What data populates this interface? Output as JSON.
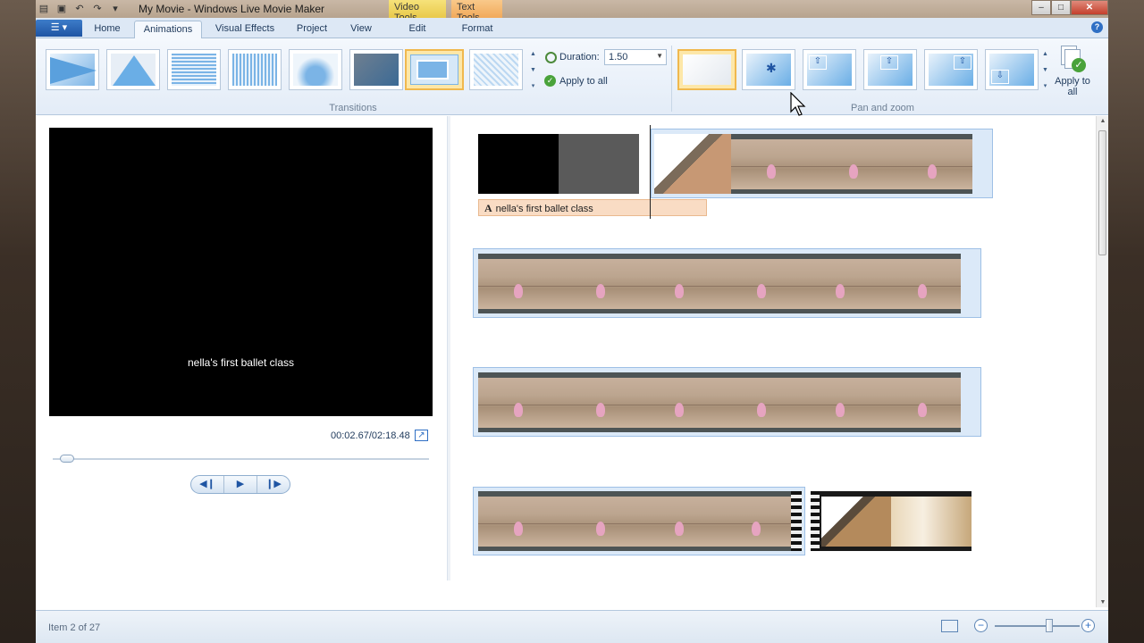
{
  "window": {
    "title": "My Movie - Windows Live Movie Maker",
    "quick_access_icons": [
      "menu-icon",
      "save-icon",
      "undo-icon",
      "redo-icon",
      "customize-icon"
    ]
  },
  "contextual_tabs": {
    "video_tools": "Video Tools",
    "text_tools": "Text Tools"
  },
  "window_controls": {
    "minimize": "‒",
    "maximize": "□",
    "close": "✕"
  },
  "ribbon_tabs": {
    "home": "Home",
    "animations": "Animations",
    "visual_effects": "Visual Effects",
    "project": "Project",
    "view": "View",
    "edit": "Edit",
    "format": "Format",
    "active": "Animations"
  },
  "transitions": {
    "group_label": "Transitions",
    "duration_label": "Duration:",
    "duration_value": "1.50",
    "apply_to_all": "Apply to all",
    "items": [
      "slide-right",
      "triangle",
      "horizontal-lines",
      "vertical-lines",
      "dissolve",
      "fade",
      "zoom-selected",
      "crosshatch"
    ],
    "selected_index": 6
  },
  "pan_zoom": {
    "group_label": "Pan and zoom",
    "items": [
      "none",
      "automatic",
      "pan-up-left",
      "pan-up",
      "pan-up-right",
      "pan-down"
    ],
    "selected_index": 0,
    "apply_to_all": "Apply to all"
  },
  "preview": {
    "caption": "nella's first ballet class",
    "time": "00:02.67/02:18.48",
    "seek_position": 0.02,
    "controls": {
      "previous": "◀❙",
      "play": "▶",
      "next": "❙▶"
    }
  },
  "storyboard": {
    "title_clip": "nella's first ballet class"
  },
  "status": {
    "item_text": "Item 2 of 27",
    "zoom_level": 0.65
  },
  "colors": {
    "accent": "#2f6fc4",
    "selection": "#f0b84e",
    "title_clip": "#f9dcc4"
  }
}
